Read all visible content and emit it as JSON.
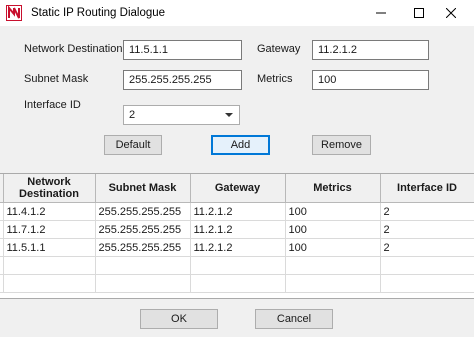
{
  "window": {
    "title": "Static IP Routing Dialogue",
    "icon": "app-n-logo-icon",
    "controls": [
      "minimize-icon",
      "maximize-icon",
      "close-icon"
    ]
  },
  "form": {
    "network_destination_label": "Network Destination",
    "network_destination_value": "11.5.1.1",
    "gateway_label": "Gateway",
    "gateway_value": "11.2.1.2",
    "subnet_mask_label": "Subnet Mask",
    "subnet_mask_value": "255.255.255.255",
    "metrics_label": "Metrics",
    "metrics_value": "100",
    "interface_id_label": "Interface ID",
    "interface_id_value": "2"
  },
  "actions": {
    "default_label": "Default",
    "add_label": "Add",
    "remove_label": "Remove"
  },
  "table": {
    "headers": [
      "Network Destination",
      "Subnet Mask",
      "Gateway",
      "Metrics",
      "Interface ID"
    ],
    "rows": [
      [
        "11.4.1.2",
        "255.255.255.255",
        "11.2.1.2",
        "100",
        "2"
      ],
      [
        "11.7.1.2",
        "255.255.255.255",
        "11.2.1.2",
        "100",
        "2"
      ],
      [
        "11.5.1.1",
        "255.255.255.255",
        "11.2.1.2",
        "100",
        "2"
      ]
    ]
  },
  "footer": {
    "ok_label": "OK",
    "cancel_label": "Cancel"
  },
  "colors": {
    "accent": "#0078d7",
    "logo_red": "#c8102e"
  }
}
